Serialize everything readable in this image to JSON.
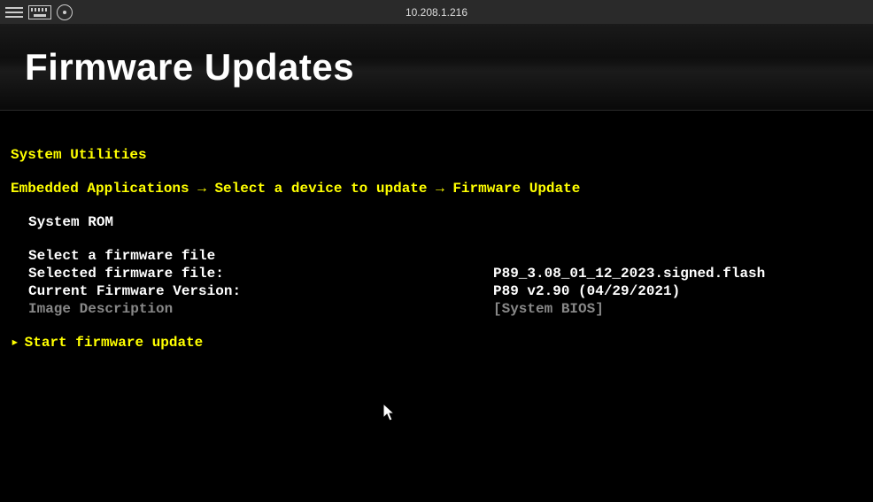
{
  "titlebar": {
    "ip": "10.208.1.216"
  },
  "header": {
    "title": "Firmware Updates"
  },
  "section_heading": "System Utilities",
  "breadcrumb": {
    "item1": "Embedded Applications",
    "item2": "Select a device to update",
    "item3": "Firmware Update"
  },
  "subheading": "System ROM",
  "info": {
    "select_file_label": "Select a firmware file",
    "selected_file_label": "Selected firmware file:",
    "selected_file_value": "P89_3.08_01_12_2023.signed.flash",
    "current_version_label": "Current Firmware Version:",
    "current_version_value": "P89 v2.90 (04/29/2021)",
    "image_desc_label": "Image Description",
    "image_desc_value": "[System BIOS]"
  },
  "action": {
    "start_update": "Start firmware update"
  }
}
